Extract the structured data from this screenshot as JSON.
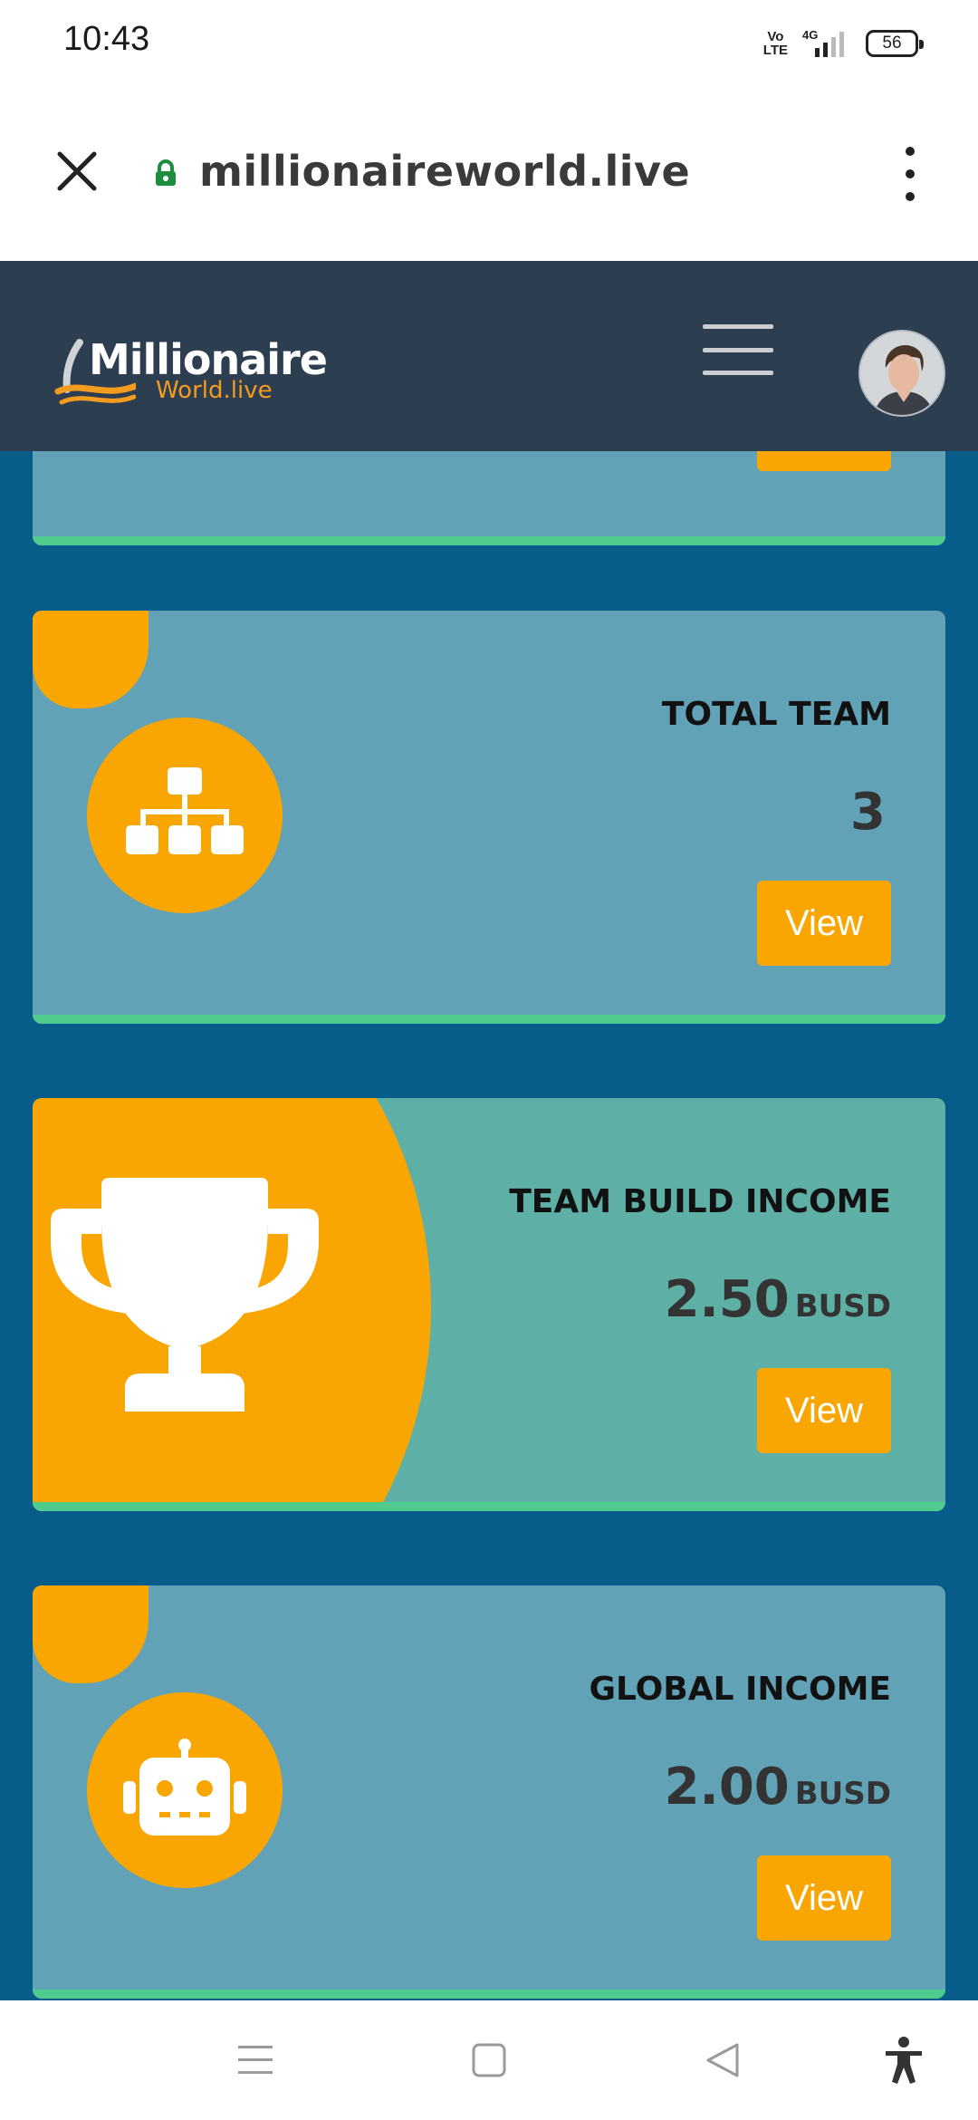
{
  "status_bar": {
    "time": "10:43",
    "volte_label": "Vo LTE",
    "network_label": "4G",
    "battery_level": "56"
  },
  "browser": {
    "url": "millionaireworld.live",
    "close_icon": "close-icon",
    "lock_icon": "lock-icon",
    "menu_icon": "more-vert-icon"
  },
  "header": {
    "logo_main": "Millionaire",
    "logo_sub": "World.live",
    "menu_icon": "hamburger-icon",
    "avatar": "user-avatar"
  },
  "cards": [
    {
      "title": "TOTAL TEAM",
      "value": "3",
      "unit": "",
      "button": "View",
      "icon": "sitemap-icon"
    },
    {
      "title": "TEAM BUILD INCOME",
      "value": "2.50",
      "unit": "BUSD",
      "button": "View",
      "icon": "trophy-icon"
    },
    {
      "title": "GLOBAL INCOME",
      "value": "2.00",
      "unit": "BUSD",
      "button": "View",
      "icon": "robot-icon"
    }
  ],
  "colors": {
    "header_bg": "#2c3e50",
    "content_bg": "#075c8a",
    "card_bg": "#62a2b7",
    "card_alt_bg": "#5eafa6",
    "accent": "#f9a602",
    "card_border": "#4ecb8d"
  },
  "nav": {
    "recents_icon": "menu-lines-icon",
    "home_icon": "square-home-icon",
    "back_icon": "triangle-back-icon",
    "accessibility_icon": "accessibility-icon"
  }
}
